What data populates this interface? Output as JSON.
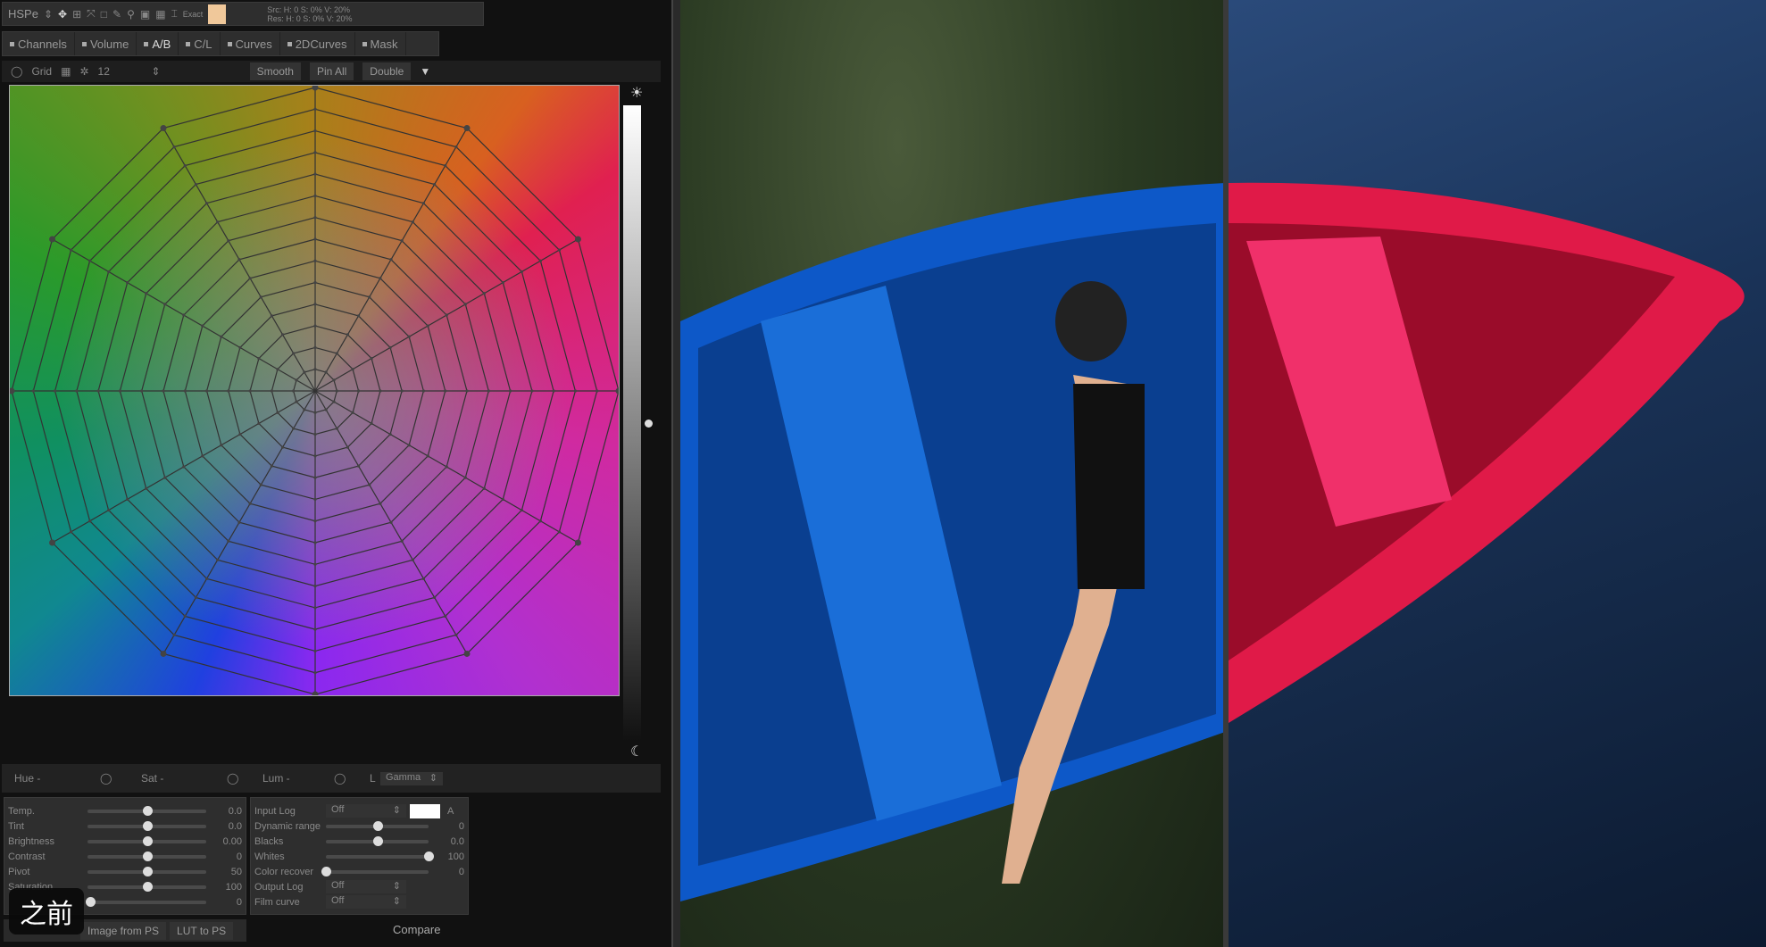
{
  "toolbar": {
    "mode": "HSPe",
    "exact": "Exact",
    "swatch_color": "#f0c89a",
    "src": "Src: H: 0   S: 0%  V: 20%",
    "res": "Res: H: 0   S: 0%  V: 20%"
  },
  "tabs": [
    {
      "label": "Channels"
    },
    {
      "label": "Volume"
    },
    {
      "label": "A/B"
    },
    {
      "label": "C/L"
    },
    {
      "label": "Curves"
    },
    {
      "label": "2DCurves"
    },
    {
      "label": "Mask"
    }
  ],
  "gridbar": {
    "grid": "Grid",
    "count": "12",
    "smooth": "Smooth",
    "pin_all": "Pin All",
    "double": "Double"
  },
  "hsl": {
    "hue": "Hue -",
    "sat": "Sat -",
    "lum": "Lum -",
    "l": "L",
    "gamma": "Gamma"
  },
  "left_sliders": [
    {
      "label": "Temp.",
      "value": "0.0",
      "pos": 0.5
    },
    {
      "label": "Tint",
      "value": "0.0",
      "pos": 0.5
    },
    {
      "label": "Brightness",
      "value": "0.00",
      "pos": 0.5
    },
    {
      "label": "Contrast",
      "value": "0",
      "pos": 0.5
    },
    {
      "label": "Pivot",
      "value": "50",
      "pos": 0.5
    },
    {
      "label": "Saturation",
      "value": "100",
      "pos": 0.5
    },
    {
      "label": "",
      "value": "0",
      "pos": 0.02
    }
  ],
  "right_panel": {
    "input_log": "Input Log",
    "input_log_val": "Off",
    "sliders": [
      {
        "label": "Dynamic range",
        "value": "0",
        "pos": 0.5
      },
      {
        "label": "Blacks",
        "value": "0.0",
        "pos": 0.5
      },
      {
        "label": "Whites",
        "value": "100",
        "pos": 1
      },
      {
        "label": "Color recover",
        "value": "0",
        "pos": 0
      }
    ],
    "output_log": "Output Log",
    "output_log_val": "Off",
    "film_curve": "Film curve",
    "film_curve_val": "Off"
  },
  "buttons": {
    "image_from_ps": "Image from PS",
    "lut_to_ps": "LUT to PS",
    "compare": "Compare"
  },
  "overlay_label": "之前",
  "auto": "A"
}
